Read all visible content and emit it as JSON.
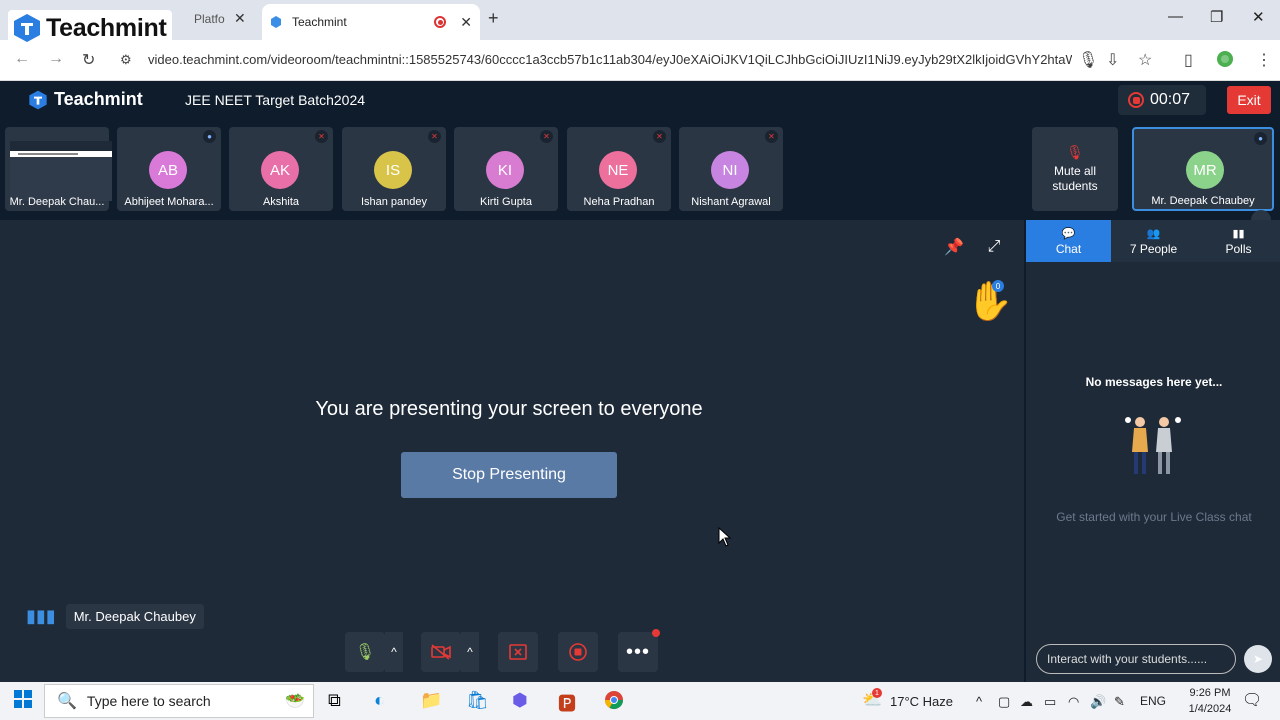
{
  "browser": {
    "tab_inactive_fragment": "Platfo",
    "tab_active_title": "Teachmint",
    "url": "video.teachmint.com/videoroom/teachmintni::1585525743/60cccc1a3ccb57b1c11ab304/eyJ0eXAiOiJKV1QiLCJhbGciOiJIUzI1NiJ9.eyJyb29tX2lkIjoidGVhY2htaW..."
  },
  "watermark": {
    "logo_text": "Teachmint"
  },
  "app": {
    "brand": "Teachmint",
    "batch_name": "JEE NEET Target Batch2024",
    "timer": "00:07",
    "exit_label": "Exit"
  },
  "participants": [
    {
      "name": "Mr. Deepak Chau...",
      "initials": "",
      "screen": true
    },
    {
      "name": "Abhijeet Mohara...",
      "initials": "AB",
      "color": "#d97ad8"
    },
    {
      "name": "Akshita",
      "initials": "AK",
      "color": "#e86fa8"
    },
    {
      "name": "Ishan pandey",
      "initials": "IS",
      "color": "#d9c44a"
    },
    {
      "name": "Kirti Gupta",
      "initials": "KI",
      "color": "#d77cd0"
    },
    {
      "name": "Neha Pradhan",
      "initials": "NE",
      "color": "#ec6f9c"
    },
    {
      "name": "Nishant Agrawal",
      "initials": "NI",
      "color": "#c784e0"
    }
  ],
  "mute_all": {
    "line1": "Mute all",
    "line2": "students"
  },
  "tutor": {
    "initials": "MR",
    "name": "Mr. Deepak Chaubey"
  },
  "stage": {
    "hand_count": "0",
    "message": "You are presenting your screen to everyone",
    "stop_label": "Stop Presenting",
    "speaker_name": "Mr. Deepak Chaubey"
  },
  "panel": {
    "tabs": [
      {
        "label": "Chat",
        "icon": "chat-icon"
      },
      {
        "label": "7 People",
        "icon": "people-icon"
      },
      {
        "label": "Polls",
        "icon": "polls-icon"
      }
    ],
    "no_messages": "No messages here yet...",
    "get_started": "Get started with your Live Class chat",
    "input_placeholder": "Interact with your students......"
  },
  "taskbar": {
    "search_placeholder": "Type here to search",
    "weather": "17°C  Haze",
    "weather_badge": "1",
    "lang": "ENG",
    "time": "9:26 PM",
    "date": "1/4/2024"
  },
  "colors": {
    "accent": "#2a7de1",
    "exit": "#e53935",
    "stop_button": "#5a7aa6",
    "background": "#1e2a38",
    "header": "#0f1c2b"
  }
}
